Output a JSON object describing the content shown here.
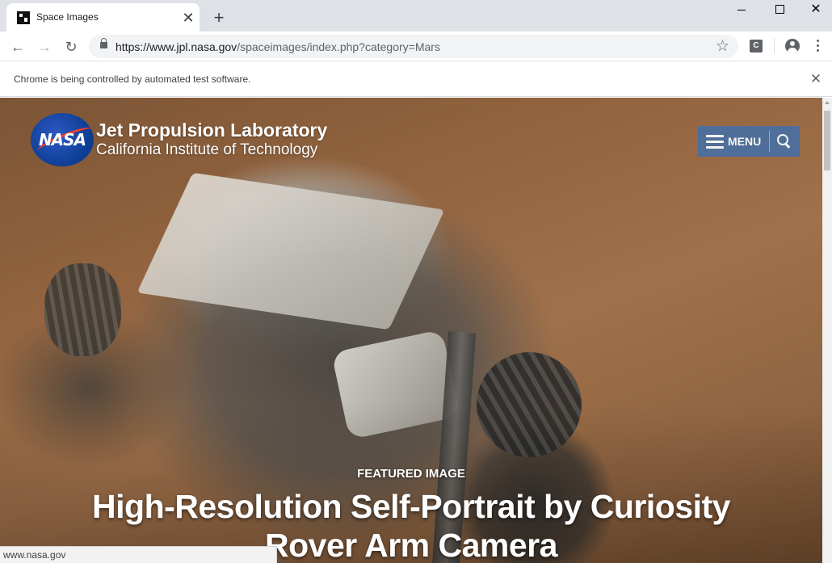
{
  "browser": {
    "tab": {
      "title": "Space Images",
      "close_glyph": "✕",
      "favicon": "jpl-favicon"
    },
    "new_tab_glyph": "+",
    "window_controls": {
      "minimize": "minimize-icon",
      "maximize": "maximize-icon",
      "close_glyph": "✕"
    },
    "nav": {
      "back_glyph": "←",
      "forward_glyph": "→",
      "reload_glyph": "↻"
    },
    "address": {
      "url_prefix": "https://www.",
      "url_domain": "jpl.nasa.gov",
      "url_path": "/spaceimages/index.php?category=Mars",
      "bookmark_glyph": "☆"
    },
    "extension_label": "C",
    "infobar": {
      "message": "Chrome is being controlled by automated test software.",
      "close_glyph": "✕"
    },
    "status_url": "www.nasa.gov"
  },
  "site": {
    "logo_text": "NASA",
    "title": "Jet Propulsion Laboratory",
    "subtitle": "California Institute of Technology",
    "menu_label": "MENU",
    "accent_color": "#4a6fa0"
  },
  "featured": {
    "label": "FEATURED IMAGE",
    "title": "High-Resolution Self-Portrait by Curiosity Rover Arm Camera"
  },
  "colors": {
    "tabstrip": "#dee1e6",
    "nasa_blue": "#0b3d91",
    "nasa_red": "#fc3d21"
  }
}
